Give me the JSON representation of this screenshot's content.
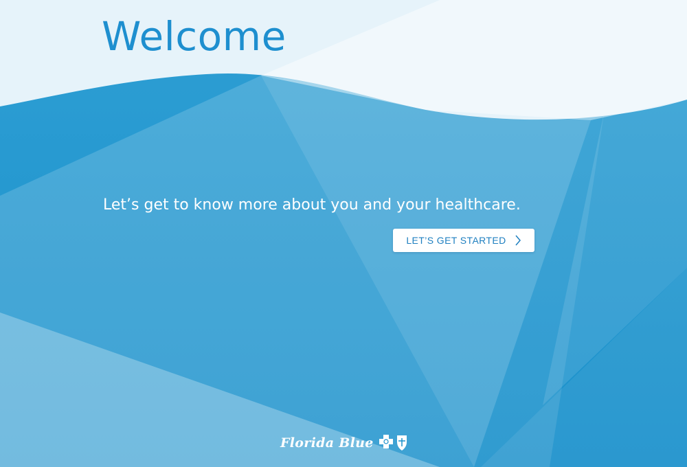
{
  "page": {
    "title": "Welcome",
    "subtitle": "Let’s get to know more about you and your healthcare.",
    "cta_label": "LET’S GET STARTED"
  },
  "footer": {
    "brand_name": "Florida Blue"
  },
  "icons": {
    "cta": "chevron-right-icon",
    "brand": "cross-shield-icon"
  },
  "colors": {
    "title": "#1e8fcf",
    "background_primary": "#2a9bd2",
    "background_light": "#e8f4fa",
    "button_text": "#1e7fc0",
    "button_bg": "#ffffff"
  }
}
